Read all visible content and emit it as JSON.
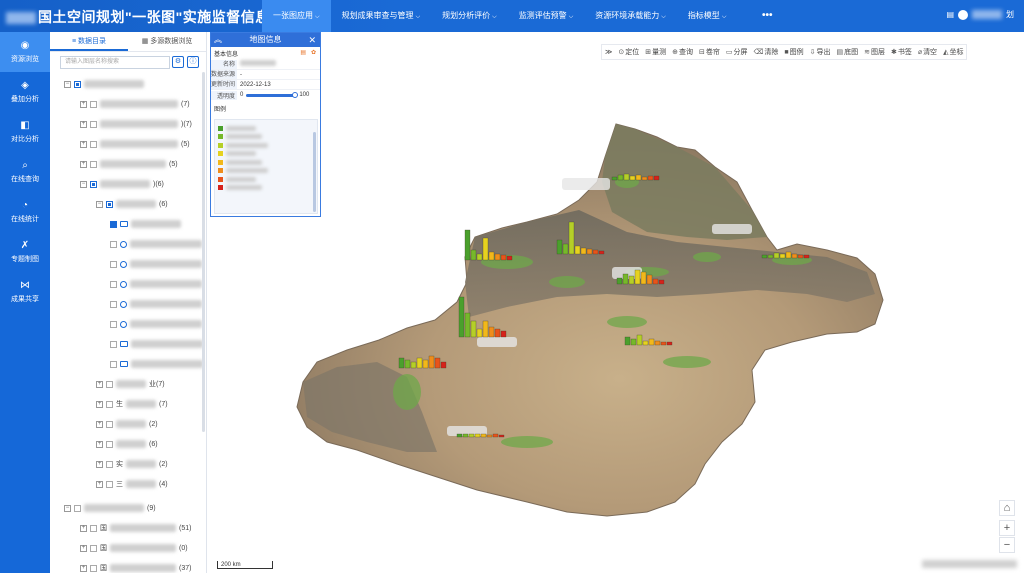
{
  "header": {
    "title": "国土空间规划\"一张图\"实施监督信息系统",
    "nav": [
      {
        "label": "一张图应用",
        "active": true
      },
      {
        "label": "规划成果审查与管理",
        "active": false
      },
      {
        "label": "规划分析评价",
        "active": false
      },
      {
        "label": "监测评估预警",
        "active": false
      },
      {
        "label": "资源环境承载能力",
        "active": false
      },
      {
        "label": "指标模型",
        "active": false
      }
    ],
    "more": "•••",
    "user_suffix": "划"
  },
  "rail": [
    {
      "label": "资源浏览",
      "icon": "globe-icon",
      "glyph": "◉",
      "active": true
    },
    {
      "label": "叠加分析",
      "icon": "layers-icon",
      "glyph": "◈",
      "active": false
    },
    {
      "label": "对比分析",
      "icon": "compare-icon",
      "glyph": "◧",
      "active": false
    },
    {
      "label": "在线查询",
      "icon": "search-icon",
      "glyph": "⌕",
      "active": false
    },
    {
      "label": "在线统计",
      "icon": "clock-icon",
      "glyph": "◔",
      "active": false
    },
    {
      "label": "专题制图",
      "icon": "tools-icon",
      "glyph": "✗",
      "active": false
    },
    {
      "label": "成果共享",
      "icon": "share-icon",
      "glyph": "⋈",
      "active": false
    }
  ],
  "catalog": {
    "tabs": [
      {
        "label": "≡ 数据目录",
        "active": true
      },
      {
        "label": "▦ 多源数据浏览",
        "active": false
      }
    ],
    "search_placeholder": "请输入图层名称搜索",
    "items": [
      {
        "suffix": "(7)"
      },
      {
        "suffix": ")(7)"
      },
      {
        "suffix": "(5)"
      },
      {
        "suffix": "(5)"
      },
      {
        "suffix": ")(6)"
      },
      {
        "suffix": "(6)"
      },
      {
        "suffix": "(5)"
      },
      {
        "suffix": "业(7)"
      },
      {
        "suffix": "(7)"
      },
      {
        "suffix": "(2)"
      },
      {
        "suffix": "(6)"
      },
      {
        "suffix": "(2)"
      },
      {
        "suffix": "(4)"
      },
      {
        "suffix": "(9)"
      },
      {
        "suffix": "(51)"
      },
      {
        "suffix": "(0)"
      },
      {
        "suffix": "(37)"
      }
    ],
    "prefixes": [
      "生",
      "三",
      "实",
      "国",
      "国",
      "国"
    ]
  },
  "toolbar": [
    {
      "label": "定位",
      "glyph": "⊙"
    },
    {
      "label": "量测",
      "glyph": "⊞"
    },
    {
      "label": "查询",
      "glyph": "⊕"
    },
    {
      "label": "卷帘",
      "glyph": "⊟"
    },
    {
      "label": "分屏",
      "glyph": "▭"
    },
    {
      "label": "清除",
      "glyph": "⌫"
    },
    {
      "label": "图例",
      "glyph": "■"
    },
    {
      "label": "导出",
      "glyph": "⇩"
    },
    {
      "label": "底图",
      "glyph": "▤"
    },
    {
      "label": "图层",
      "glyph": "≋"
    },
    {
      "label": "书签",
      "glyph": "✱"
    },
    {
      "label": "清空",
      "glyph": "⌀"
    },
    {
      "label": "坐标",
      "glyph": "◭"
    }
  ],
  "info": {
    "title": "地图信息",
    "section": "基本信息",
    "fields": [
      {
        "k": "名称",
        "v": ""
      },
      {
        "k": "数据来源",
        "v": "-"
      },
      {
        "k": "更新时间",
        "v": "2022-12-13"
      }
    ],
    "opacity_label": "透明度",
    "opacity_min": "0",
    "opacity_max": "100",
    "legend_title": "图例",
    "legend_colors": [
      "#4aa02c",
      "#76b82a",
      "#b5cf27",
      "#e6d21f",
      "#f2b81a",
      "#ef8d1b",
      "#e8531a",
      "#d6221b"
    ]
  },
  "scale": "200 km"
}
